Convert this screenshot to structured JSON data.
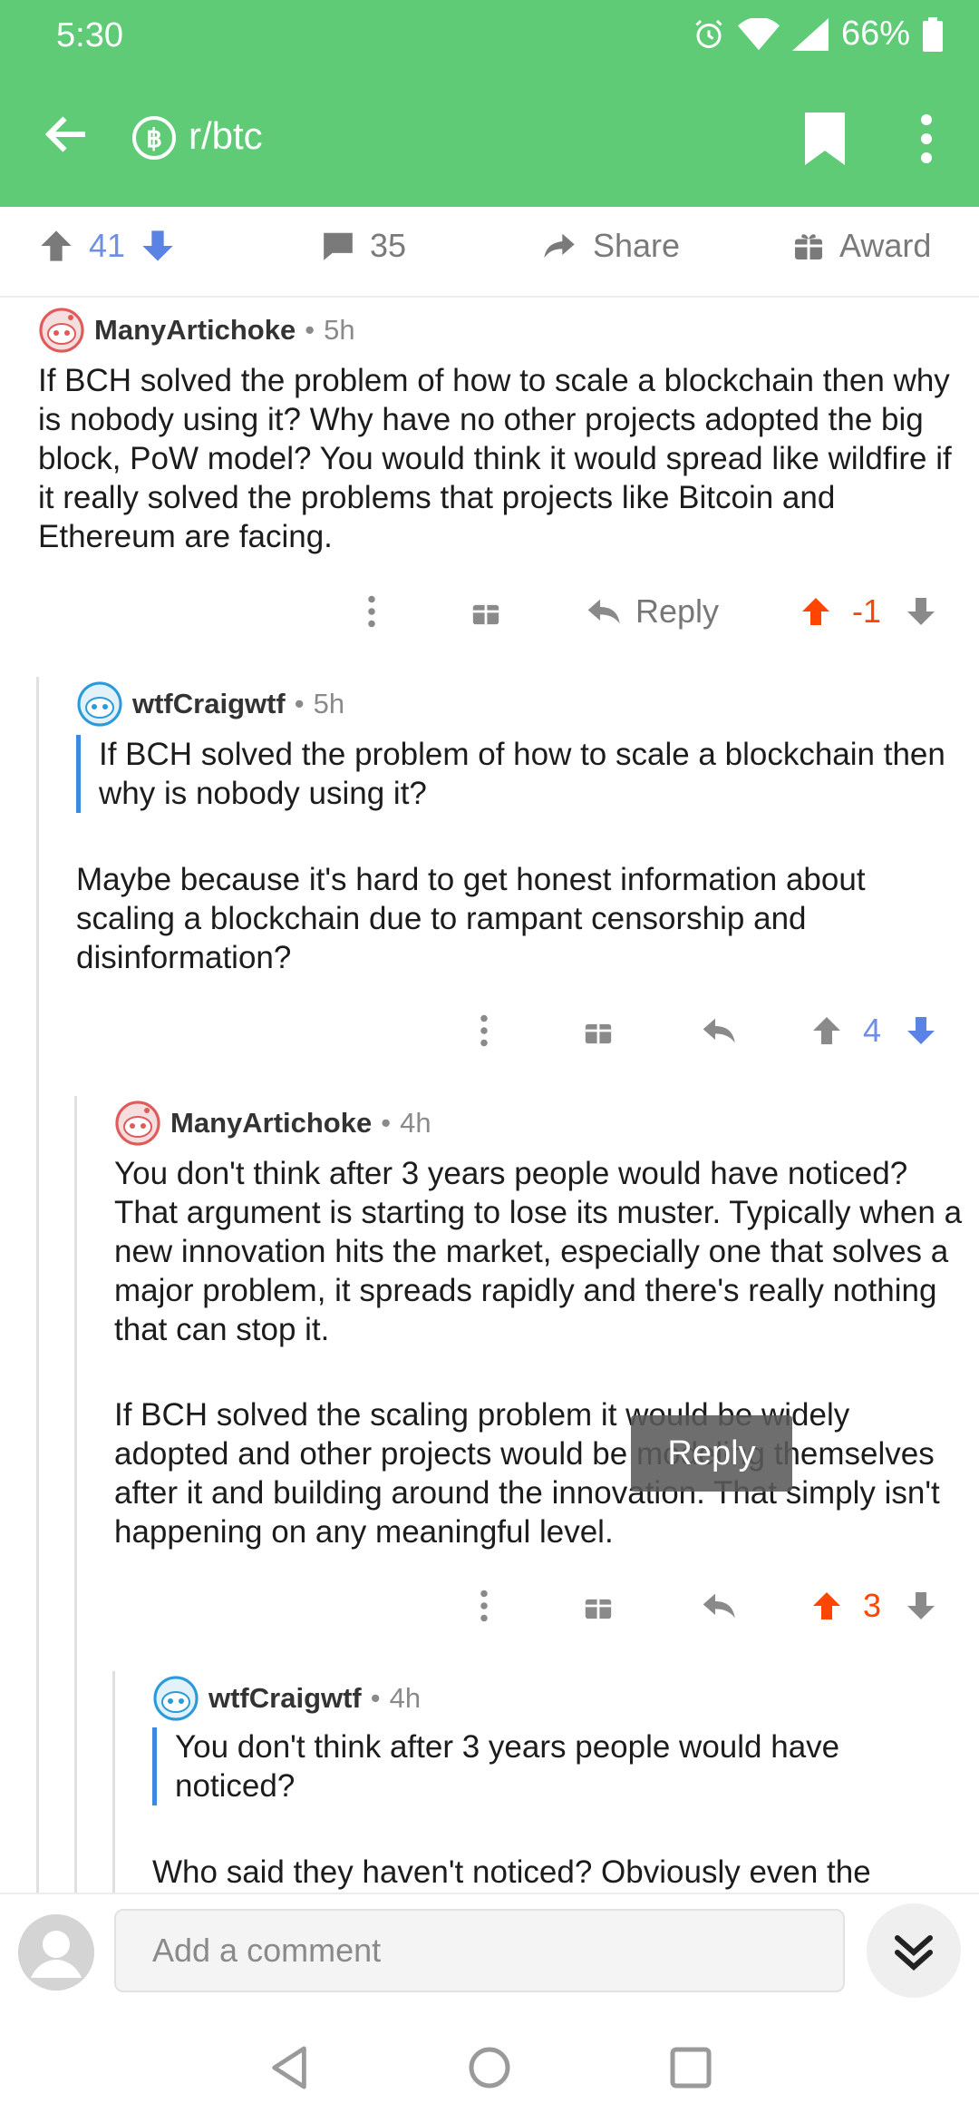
{
  "status": {
    "time": "5:30",
    "battery": "66%"
  },
  "header": {
    "subreddit": "r/btc",
    "sub_icon": "฿"
  },
  "post_bar": {
    "upvotes": "41",
    "comments": "35",
    "share": "Share",
    "award": "Award"
  },
  "comments": [
    {
      "user": "ManyArtichoke",
      "age": "5h",
      "body": "If BCH solved the problem of how to scale a blockchain then why is nobody using it? Why have no other projects adopted the big block, PoW model? You would think it would spread like wildfire if it really solved the problems that projects like Bitcoin and Ethereum are facing.",
      "reply": "Reply",
      "score": "-1"
    },
    {
      "user": "wtfCraigwtf",
      "age": "5h",
      "quote": "If BCH solved the problem of how to scale a blockchain then why is nobody using it?",
      "body": "Maybe because it's hard to get honest information about scaling a blockchain due to rampant censorship and disinformation?",
      "score": "4"
    },
    {
      "user": "ManyArtichoke",
      "age": "4h",
      "body": "You don't think after 3 years people would have noticed? That argument is starting to lose its muster. Typically when a new innovation hits the market, especially one that solves a major problem, it spreads rapidly and there's really nothing that can stop it.",
      "body2": "If BCH solved the scaling problem it would be widely adopted and other projects would be modeling themselves after it and building around the innovation. That simply isn't happening on any meaningful level.",
      "score": "3"
    },
    {
      "user": "wtfCraigwtf",
      "age": "4h",
      "quote": "You don't think after 3 years people would have noticed?",
      "body": "Who said they haven't noticed? Obviously even the"
    }
  ],
  "tooltip": "Reply",
  "composer": {
    "placeholder": "Add a comment"
  },
  "colors": {
    "header": "#5fcb77",
    "upvote": "#ff4500",
    "vote_blue": "#6f8fe6",
    "quote_bar": "#3a8be0"
  }
}
